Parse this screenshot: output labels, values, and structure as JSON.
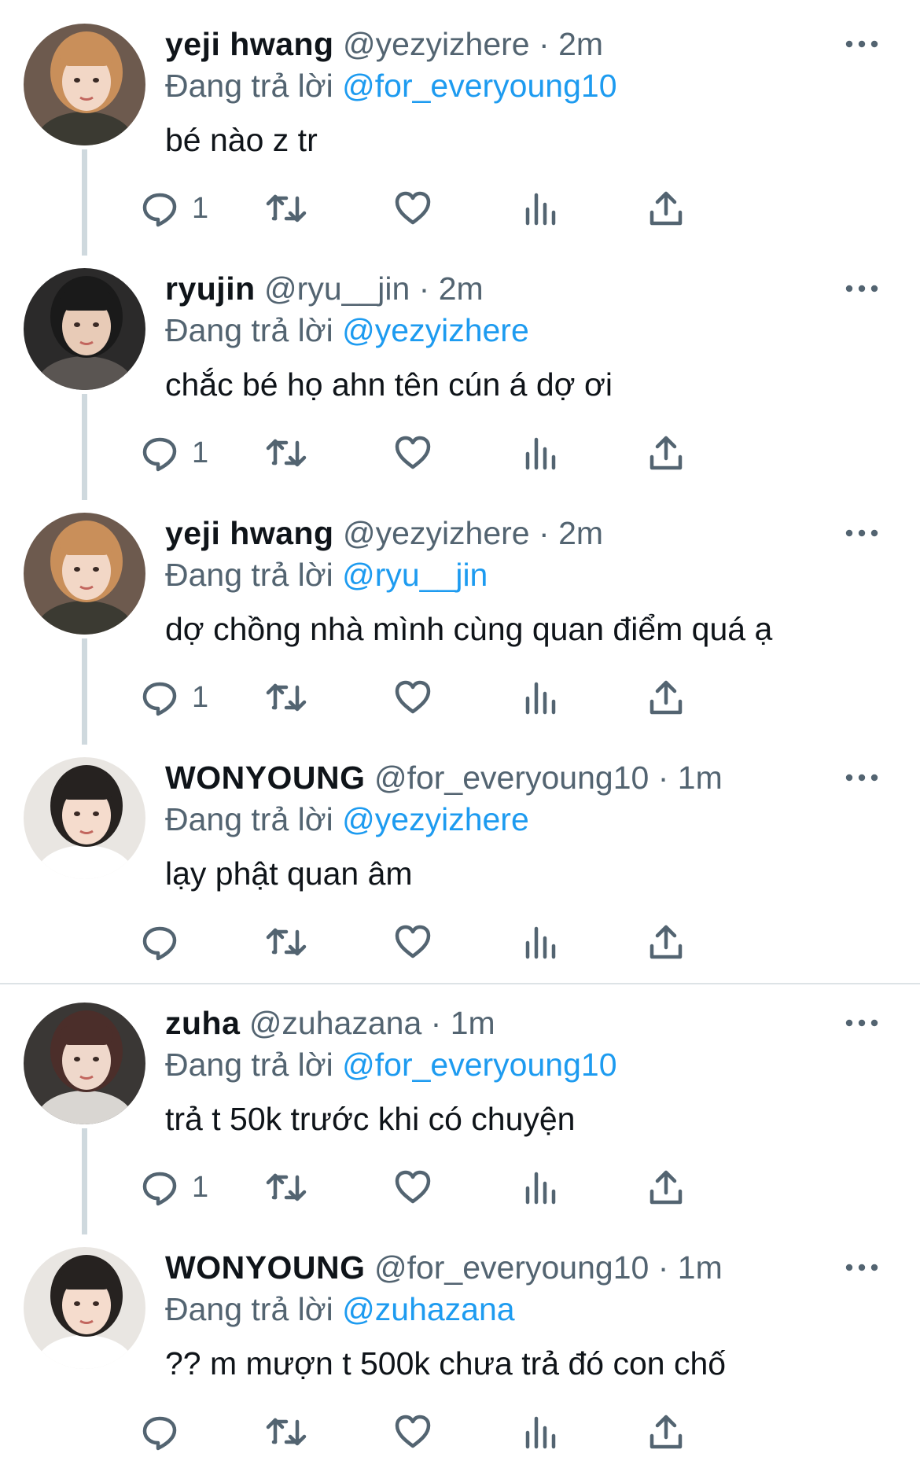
{
  "labels": {
    "replying_to": "Đang trả lời"
  },
  "tweets": [
    {
      "name": "yeji hwang",
      "handle": "@yezyizhere",
      "dot": "·",
      "time": "2m",
      "replying_to": "@for_everyoung10",
      "text": "bé nào z tr",
      "reply_count": "1",
      "thread_continues": true
    },
    {
      "name": "ryujin",
      "handle": "@ryu__jin",
      "dot": "·",
      "time": "2m",
      "replying_to": "@yezyizhere",
      "text": "chắc bé họ ahn tên cún á dợ ơi",
      "reply_count": "1",
      "thread_continues": true
    },
    {
      "name": "yeji hwang",
      "handle": "@yezyizhere",
      "dot": "·",
      "time": "2m",
      "replying_to": "@ryu__jin",
      "text": "dợ chồng nhà mình cùng quan điểm quá ạ",
      "reply_count": "1",
      "thread_continues": true
    },
    {
      "name": "WONYOUNG",
      "handle": "@for_everyoung10",
      "dot": "·",
      "time": "1m",
      "replying_to": "@yezyizhere",
      "text": "lạy phật quan âm",
      "reply_count": "",
      "thread_continues": false
    },
    {
      "name": "zuha",
      "handle": "@zuhazana",
      "dot": "·",
      "time": "1m",
      "replying_to": "@for_everyoung10",
      "text": "trả t 50k trước khi có chuyện",
      "reply_count": "1",
      "thread_continues": true
    },
    {
      "name": "WONYOUNG",
      "handle": "@for_everyoung10",
      "dot": "·",
      "time": "1m",
      "replying_to": "@zuhazana",
      "text": "?? m mượn t 500k chưa trả đó con chố",
      "reply_count": "",
      "thread_continues": false
    }
  ],
  "icons": {
    "reply": "reply-icon",
    "retweet": "retweet-icon",
    "like": "heart-icon",
    "views": "views-icon",
    "share": "share-icon",
    "more": "more-icon"
  },
  "colors": {
    "text": "#0f1419",
    "secondary": "#536471",
    "mention": "#1d9bf0",
    "thread_line": "#cfd9de",
    "divider": "#dde3e6"
  }
}
